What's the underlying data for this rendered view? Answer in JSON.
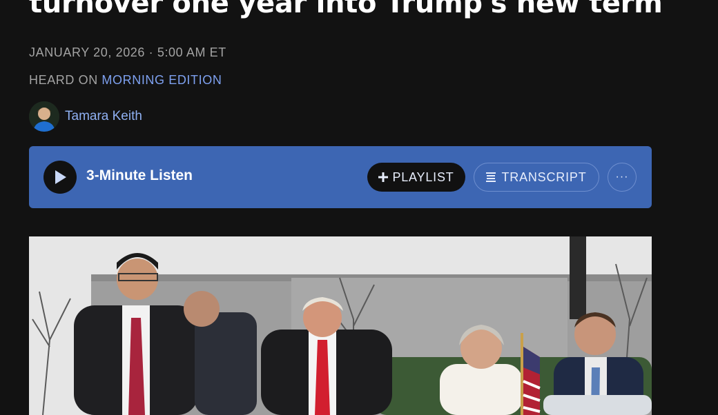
{
  "article": {
    "headline": "turnover one year into Trump's new term",
    "dateline": "JANUARY 20, 2026 · 5:00 AM ET",
    "heard_on_prefix": "HEARD ON",
    "program": "MORNING EDITION",
    "author": "Tamara Keith"
  },
  "player": {
    "listen_label": "3-Minute Listen",
    "playlist_label": "PLAYLIST",
    "transcript_label": "TRANSCRIPT",
    "more_label": "···"
  },
  "colors": {
    "background": "#121212",
    "player_bg": "#3d66b3",
    "link": "#7ea1f0"
  },
  "icons": {
    "play": "play-icon",
    "plus": "plus-icon",
    "transcript": "transcript-lines-icon",
    "more": "ellipsis-icon"
  }
}
